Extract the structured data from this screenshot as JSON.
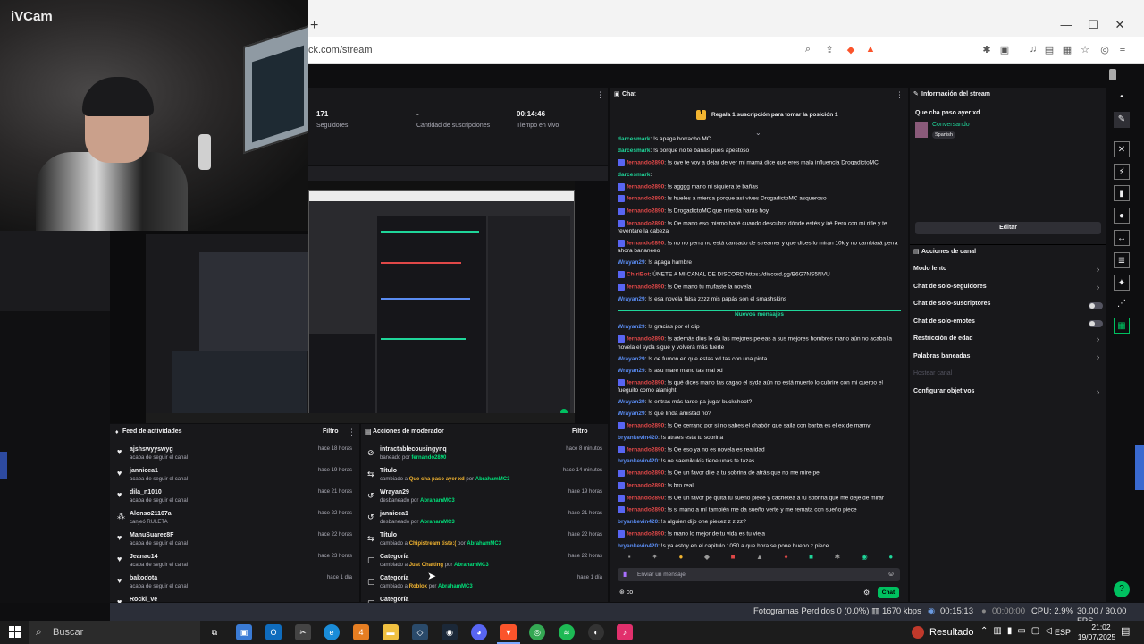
{
  "ivcam": {
    "title": "iVCam"
  },
  "browser": {
    "url": "ck.com/stream",
    "new_tab": "+",
    "minimize": "—",
    "maximize": "☐",
    "close": "✕"
  },
  "stats": {
    "followers_value": "171",
    "followers_label": "Seguidores",
    "subs_value": "-",
    "subs_label": "Cantidad de suscripciones",
    "live_value": "00:14:46",
    "live_label": "Tiempo en vivo"
  },
  "activity": {
    "title": "Feed de actividades",
    "filter": "Filtro",
    "items": [
      {
        "name": "ajshswyyswyg",
        "sub": "acaba de seguir el canal",
        "time": "hace 18 horas"
      },
      {
        "name": "jannicea1",
        "sub": "acaba de seguir el canal",
        "time": "hace 19 horas"
      },
      {
        "name": "dila_n1010",
        "sub": "acaba de seguir el canal",
        "time": "hace 21 horas"
      },
      {
        "name": "Alonso21107a",
        "sub": "canjeó RULETA",
        "time": "hace 22 horas"
      },
      {
        "name": "ManuSuarez8F",
        "sub": "acaba de seguir el canal",
        "time": "hace 22 horas"
      },
      {
        "name": "Jeanac14",
        "sub": "acaba de seguir el canal",
        "time": "hace 23 horas"
      },
      {
        "name": "bakodota",
        "sub": "acaba de seguir el canal",
        "time": "hace 1 día"
      },
      {
        "name": "Rocki_Ve",
        "sub": "",
        "time": ""
      }
    ]
  },
  "modactions": {
    "title": "Acciones de moderador",
    "filter": "Filtro",
    "items": [
      {
        "name": "intractablecousingynq",
        "pre": "baneado por ",
        "target": "",
        "mid": "",
        "by": "fernando2890",
        "time": "hace 8 minutos"
      },
      {
        "name": "Título",
        "pre": "cambiado a ",
        "target": "Que cha paso ayer xd",
        "mid": " por ",
        "by": "AbrahamMC3",
        "time": "hace 14 minutos"
      },
      {
        "name": "Wrayan29",
        "pre": "desbaneado por ",
        "target": "",
        "mid": "",
        "by": "AbrahamMC3",
        "time": "hace 19 horas"
      },
      {
        "name": "jannicea1",
        "pre": "desbaneado por ",
        "target": "",
        "mid": "",
        "by": "AbrahamMC3",
        "time": "hace 21 horas"
      },
      {
        "name": "Título",
        "pre": "cambiado a ",
        "target": "Chipistream tiste:(",
        "mid": " por ",
        "by": "AbrahamMC3",
        "time": "hace 22 horas"
      },
      {
        "name": "Categoría",
        "pre": "cambiado a ",
        "target": "Just Chatting",
        "mid": " por ",
        "by": "AbrahamMC3",
        "time": "hace 22 horas"
      },
      {
        "name": "Categoría",
        "pre": "cambiado a ",
        "target": "Roblox",
        "mid": " por ",
        "by": "AbrahamMC3",
        "time": "hace 1 día"
      },
      {
        "name": "Categoría",
        "pre": "",
        "target": "",
        "mid": "",
        "by": "",
        "time": ""
      }
    ]
  },
  "chat": {
    "title": "Chat",
    "pinned": "Regala 1 suscripción para tomar la posición 1",
    "new_messages": "Nuevos mensajes",
    "input_placeholder": "Enviar un mensaje",
    "send": "Chat",
    "messages": [
      {
        "user": "darcesmark",
        "color": "green",
        "badge": false,
        "text": ": !s apaga borracho MC"
      },
      {
        "user": "darcesmark",
        "color": "green",
        "badge": false,
        "text": ": !s porque no te bañas pues apestoso"
      },
      {
        "user": "fernando2890",
        "color": "red",
        "badge": true,
        "text": ": !s oye te voy a dejar de ver mi mamá dice que eres mala influencia DrogadictoMC"
      },
      {
        "user": "darcesmark",
        "color": "green",
        "badge": false,
        "text": ":"
      },
      {
        "user": "fernando2890",
        "color": "red",
        "badge": true,
        "text": ": !s agggg mano ni siquiera te bañas"
      },
      {
        "user": "fernando2890",
        "color": "red",
        "badge": true,
        "text": ": !s hueles a mierda porque así vives DrogadictoMC asqueroso"
      },
      {
        "user": "fernando2890",
        "color": "red",
        "badge": true,
        "text": ": !s DrogadictoMC que mierda harás hoy"
      },
      {
        "user": "fernando2890",
        "color": "red",
        "badge": true,
        "text": ": !s Oe mano eso mismo haré cuando descubra dónde estés y iré Pero con mi rifle y te reventare la cabeza"
      },
      {
        "user": "fernando2890",
        "color": "red",
        "badge": true,
        "text": ": !s no no perra no está cansado de streamer y que dices lo miran 10k y no cambiará perra ahora bananeeo"
      },
      {
        "user": "Wrayan29",
        "color": "blue",
        "badge": false,
        "text": ": !s apaga hambre"
      },
      {
        "user": "ChiriBot",
        "color": "red",
        "badge": true,
        "text": ": ÚNETE A MI CANAL DE DISCORD https://discord.gg/B6G7NS5NVU"
      },
      {
        "user": "fernando2890",
        "color": "red",
        "badge": true,
        "text": ": !s Oe mano tu mufaste la novela"
      },
      {
        "user": "Wrayan29",
        "color": "blue",
        "badge": false,
        "text": ": !s esa novela falsa zzzz mis papás son el smashskins"
      },
      {
        "user": "Wrayan29",
        "color": "blue",
        "badge": false,
        "text": ": !s gracias por el clip"
      },
      {
        "user": "fernando2890",
        "color": "red",
        "badge": true,
        "text": ": !s además dios le da las mejores peleas a sus mejores hombres mano aún no acaba la novela el syda sigue y volverá más fuerte"
      },
      {
        "user": "Wrayan29",
        "color": "blue",
        "badge": false,
        "text": ": !s oe fumon en que estas xd tas con una pinta"
      },
      {
        "user": "Wrayan29",
        "color": "blue",
        "badge": false,
        "text": ": !s asu mare mano tas mal xd"
      },
      {
        "user": "fernando2890",
        "color": "red",
        "badge": true,
        "text": ": !s qué dices mano tas cagao el syda aún no está muerto lo cubrire con mi cuerpo el fueguito como alanight"
      },
      {
        "user": "Wrayan29",
        "color": "blue",
        "badge": false,
        "text": ": !s entras más tarde pa jugar buckshoot?"
      },
      {
        "user": "Wrayan29",
        "color": "blue",
        "badge": false,
        "text": ": !s que linda amistad no?"
      },
      {
        "user": "fernando2890",
        "color": "red",
        "badge": true,
        "text": ": !s Oe cerrano por si no sabes el chabón que saila con barba es el ex de mamy"
      },
      {
        "user": "bryankevin420",
        "color": "blue",
        "badge": false,
        "text": ": !s atraes esta tu sobrina"
      },
      {
        "user": "fernando2890",
        "color": "red",
        "badge": true,
        "text": ": !s Oe eso ya no es novela es realidad"
      },
      {
        "user": "bryankevin420",
        "color": "blue",
        "badge": false,
        "text": ": !s oe saemikukis tiene unas te tazas"
      },
      {
        "user": "fernando2890",
        "color": "red",
        "badge": true,
        "text": ": !s Oe un favor dile a tu sobrina de atrás que no me mire pe"
      },
      {
        "user": "fernando2890",
        "color": "red",
        "badge": true,
        "text": ": !s bro real"
      },
      {
        "user": "fernando2890",
        "color": "red",
        "badge": true,
        "text": ": !s Oe un favor pe quita tu sueño piece y cachetea a tu sobrina que me deje de mirar"
      },
      {
        "user": "fernando2890",
        "color": "red",
        "badge": true,
        "text": ": !s si mano a mí también me da sueño verte y me remata con sueño piece"
      },
      {
        "user": "bryankevin420",
        "color": "blue",
        "badge": false,
        "text": ": !s alguien dijo one piecez z z zz?"
      },
      {
        "user": "fernando2890",
        "color": "red",
        "badge": true,
        "text": ": !s mano lo mejor de tu vida es tu vieja"
      },
      {
        "user": "bryankevin420",
        "color": "blue",
        "badge": false,
        "text": ": !s ya estoy en el capitulo 1050 a que hora se pone bueno z piece"
      }
    ]
  },
  "stream_info": {
    "title": "Información del stream",
    "stream_title": "Que cha paso ayer xd",
    "category": "Conversando",
    "language": "Spanish",
    "edit": "Editar"
  },
  "channel_actions": {
    "title": "Acciones de canal",
    "items": [
      {
        "label": "Modo lento",
        "kind": "chevron"
      },
      {
        "label": "Chat de solo-seguidores",
        "kind": "chevron"
      },
      {
        "label": "Chat de solo-suscriptores",
        "kind": "toggle"
      },
      {
        "label": "Chat de solo-emotes",
        "kind": "toggle"
      },
      {
        "label": "Restricción de edad",
        "kind": "chevron"
      },
      {
        "label": "Palabras baneadas",
        "kind": "chevron"
      },
      {
        "label": "Hostear canal",
        "kind": "disabled"
      },
      {
        "label": "Configurar objetivos",
        "kind": "chevron"
      }
    ]
  },
  "obs": {
    "frames": "Fotogramas Perdidos 0 (0.0%)",
    "bitrate": "1670 kbps",
    "live": "00:15:13",
    "rec": "00:00:00",
    "cpu": "CPU: 2.9%",
    "fps": "30.00 / 30.00 FPS"
  },
  "taskbar": {
    "search": "Buscar",
    "weather": "Resultado",
    "lang": "ESP",
    "time": "21:02",
    "date": "19/07/2025"
  }
}
